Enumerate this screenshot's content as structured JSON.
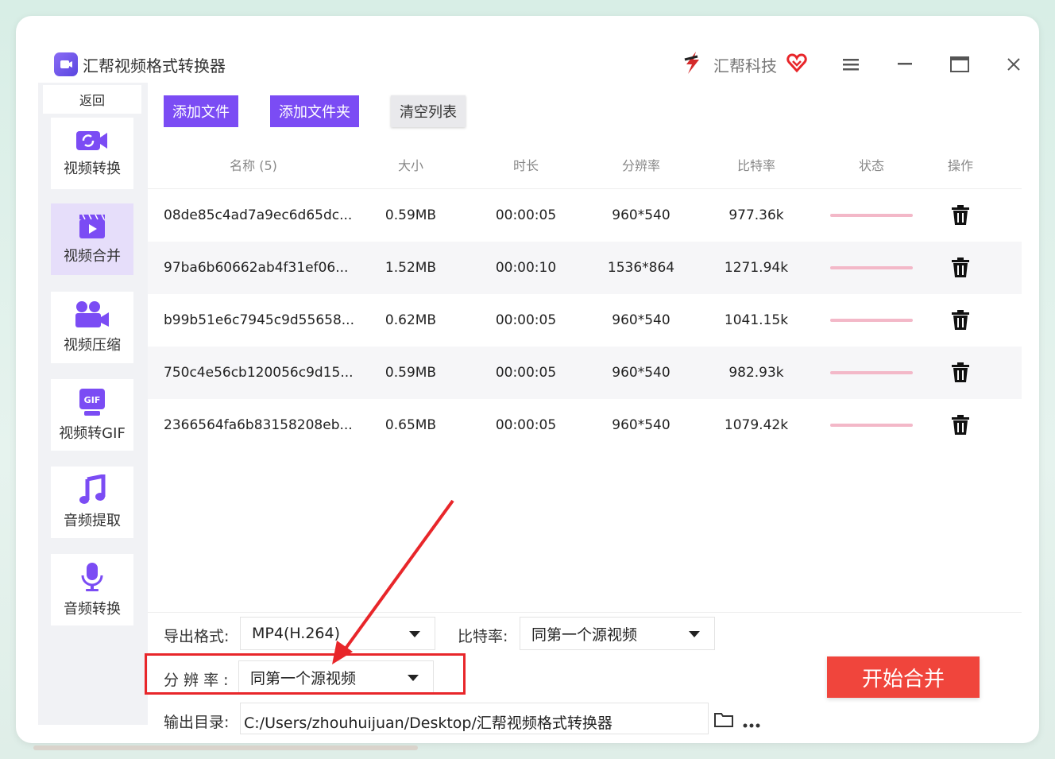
{
  "app": {
    "title": "汇帮视频格式转换器",
    "brand": "汇帮科技"
  },
  "sidebar": {
    "back_label": "返回",
    "items": [
      {
        "label": "视频转换",
        "icon": "video-convert-icon"
      },
      {
        "label": "视频合并",
        "icon": "video-merge-icon",
        "active": true
      },
      {
        "label": "视频压缩",
        "icon": "video-compress-icon"
      },
      {
        "label": "视频转GIF",
        "icon": "gif-icon"
      },
      {
        "label": "音频提取",
        "icon": "music-note-icon"
      },
      {
        "label": "音频转换",
        "icon": "microphone-icon"
      }
    ]
  },
  "toolbar": {
    "add_file": "添加文件",
    "add_folder": "添加文件夹",
    "clear_list": "清空列表"
  },
  "table": {
    "headers": [
      "名称 (5)",
      "大小",
      "时长",
      "分辨率",
      "比特率",
      "状态",
      "操作"
    ],
    "rows": [
      {
        "name": "08de85c4ad7a9ec6d65dc...",
        "size": "0.59MB",
        "duration": "00:00:05",
        "resolution": "960*540",
        "bitrate": "977.36k"
      },
      {
        "name": "97ba6b60662ab4f31ef06...",
        "size": "1.52MB",
        "duration": "00:00:10",
        "resolution": "1536*864",
        "bitrate": "1271.94k"
      },
      {
        "name": "b99b51e6c7945c9d55658...",
        "size": "0.62MB",
        "duration": "00:00:05",
        "resolution": "960*540",
        "bitrate": "1041.15k"
      },
      {
        "name": "750c4e56cb120056c9d15...",
        "size": "0.59MB",
        "duration": "00:00:05",
        "resolution": "960*540",
        "bitrate": "982.93k"
      },
      {
        "name": "2366564fa6b83158208eb...",
        "size": "0.65MB",
        "duration": "00:00:05",
        "resolution": "960*540",
        "bitrate": "1079.42k"
      }
    ]
  },
  "settings": {
    "format_label": "导出格式:",
    "format_value": "MP4(H.264)",
    "bitrate_label": "比特率:",
    "bitrate_value": "同第一个源视频",
    "resolution_label": "分 辨 率 :",
    "resolution_value": "同第一个源视频",
    "output_label": "输出目录:",
    "output_value": "C:/Users/zhouhuijuan/Desktop/汇帮视频格式转换器"
  },
  "start_button": "开始合并",
  "colors": {
    "accent": "#7b4cf4",
    "start": "#f0453c",
    "highlight": "#e8262a"
  }
}
